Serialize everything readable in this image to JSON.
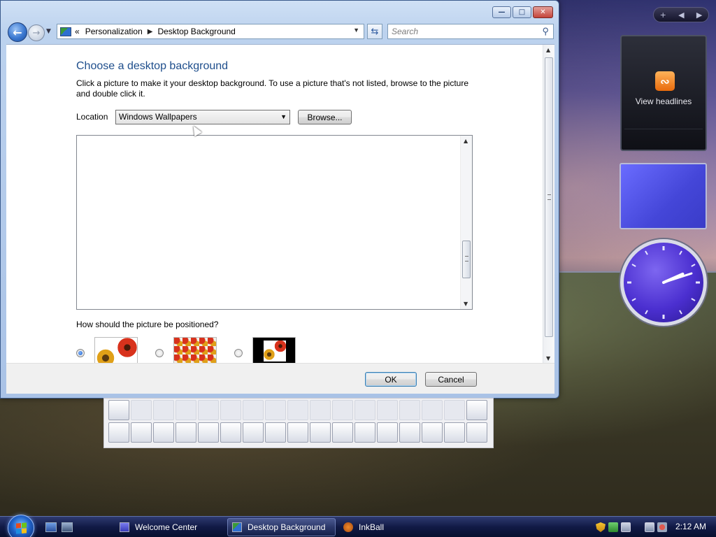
{
  "window": {
    "caption_buttons": [
      "minimize-icon",
      "maximize-icon",
      "close-icon"
    ],
    "breadcrumb": {
      "overflow": "«",
      "items": [
        "Personalization",
        "Desktop Background"
      ]
    },
    "search": {
      "placeholder": "Search"
    },
    "heading": "Choose a desktop background",
    "description": "Click a picture to make it your desktop background. To use a picture that's not listed, browse to the picture and double click it.",
    "location": {
      "label": "Location",
      "selected": "Windows Wallpapers"
    },
    "browse_label": "Browse...",
    "position_question": "How should the picture be positioned?",
    "position_options": [
      {
        "name": "fit-to-screen",
        "selected": true
      },
      {
        "name": "tile",
        "selected": false
      },
      {
        "name": "center",
        "selected": false
      }
    ],
    "ok_label": "OK",
    "cancel_label": "Cancel"
  },
  "gadgets": {
    "feed_headlines": {
      "text": "View headlines",
      "icon": "rss-feed-icon"
    },
    "slideshow": {
      "color": "#4446d8"
    },
    "clock": {
      "hour": 2,
      "minute": 12
    }
  },
  "taskbar": {
    "buttons": [
      {
        "label": "Welcome Center",
        "icon": "welcome-center-icon",
        "active": false
      },
      {
        "label": "Desktop Background",
        "icon": "control-panel-icon",
        "active": true
      },
      {
        "label": "InkBall",
        "icon": "inkball-icon",
        "active": false
      }
    ],
    "tray_icons": [
      "security-shield-icon",
      "network-icon",
      "windows-update-icon",
      "network-connection-icon",
      "volume-muted-icon"
    ],
    "clock": "2:12 AM"
  },
  "colors": {
    "heading": "#1e4e8c",
    "taskbar": "#111a46",
    "clock_face": "#4b2fd0"
  }
}
